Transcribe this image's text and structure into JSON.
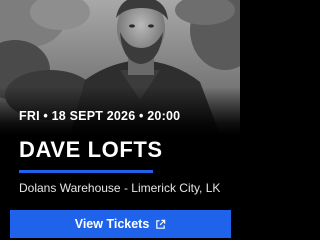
{
  "event": {
    "date_line": "FRI • 18 SEPT 2026 • 20:00",
    "artist": "DAVE LOFTS",
    "venue": "Dolans Warehouse - Limerick City, LK"
  },
  "cta": {
    "label": "View Tickets",
    "icon": "external-link-icon"
  },
  "colors": {
    "accent": "#1e63e9",
    "background": "#000000",
    "text": "#ffffff"
  }
}
